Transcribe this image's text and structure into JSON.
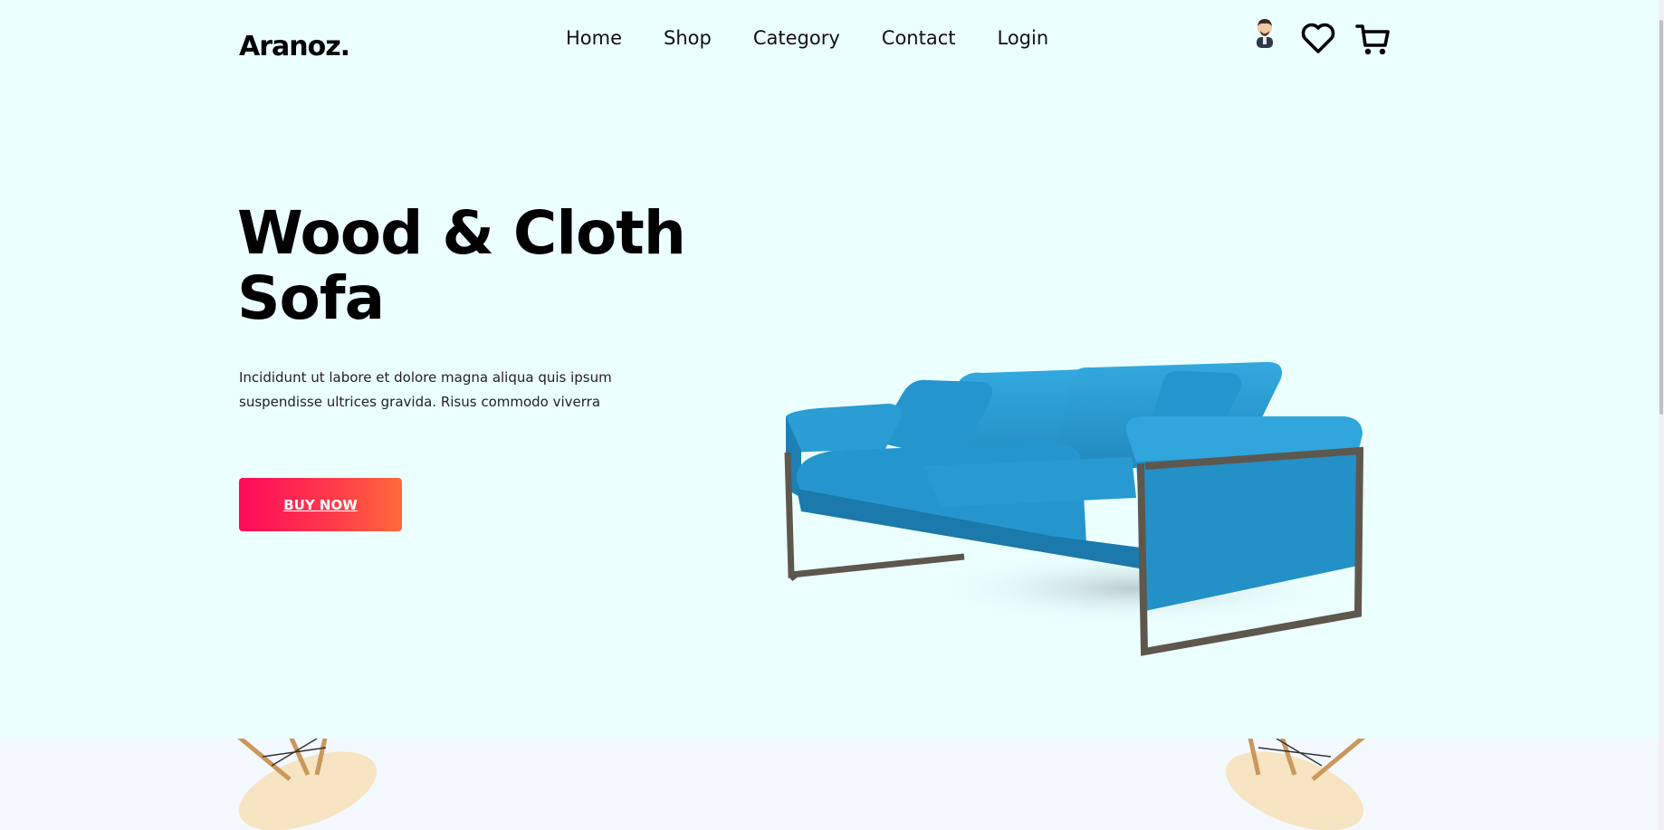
{
  "brand": {
    "logo": "Aranoz."
  },
  "nav": {
    "links": [
      "Home",
      "Shop",
      "Category",
      "Contact",
      "Login"
    ]
  },
  "icons": {
    "avatar": "avatar-icon",
    "wishlist": "heart-icon",
    "cart": "cart-icon"
  },
  "hero": {
    "title_line1": "Wood & Cloth",
    "title_line2": "Sofa",
    "description": "Incididunt ut labore et dolore magna aliqua quis ipsum suspendisse ultrices gravida. Risus commodo viverra",
    "button_label": "BUY NOW"
  },
  "colors": {
    "background": "#ecffff",
    "accent_start": "#ff0a5a",
    "accent_end": "#ff6a3a",
    "sofa": "#2a9bd3"
  }
}
